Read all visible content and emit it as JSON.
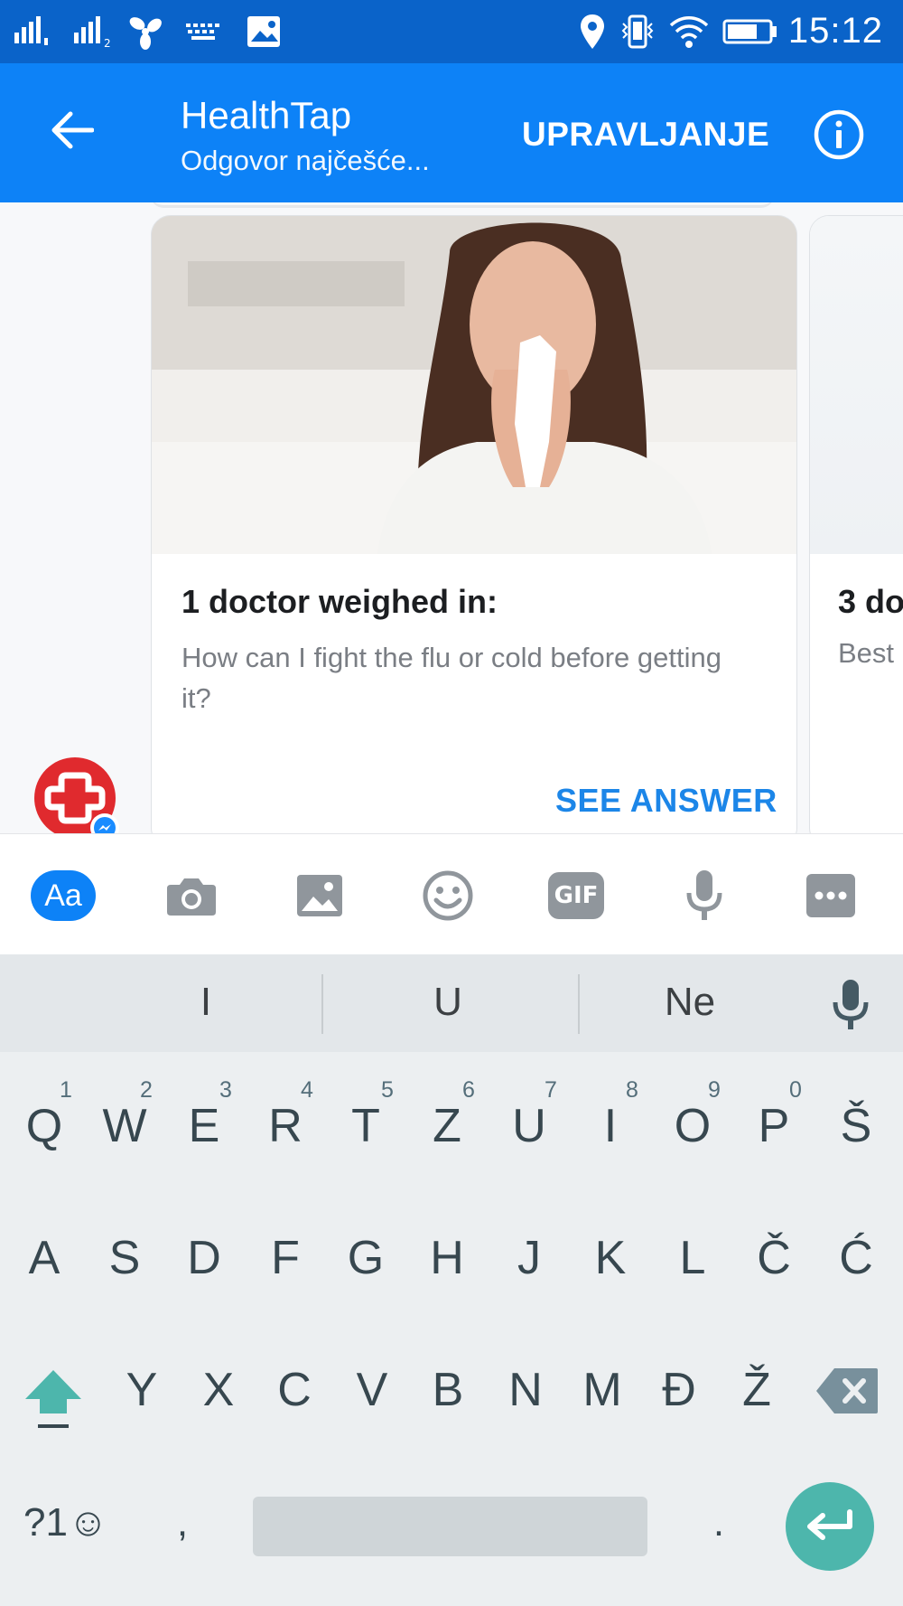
{
  "status_bar": {
    "time": "15:12",
    "icons": [
      "signal-1-icon",
      "signal-2-icon",
      "fan-icon",
      "keyboard-icon",
      "image-icon",
      "location-icon",
      "vibrate-icon",
      "wifi-icon",
      "battery-icon"
    ]
  },
  "header": {
    "title": "HealthTap",
    "subtitle": "Odgovor najčešće...",
    "manage_label": "UPRAVLJANJE"
  },
  "cards": [
    {
      "heading": "1 doctor weighed in:",
      "text": "How can I fight the flu or cold before getting it?",
      "action": "SEE ANSWER"
    },
    {
      "heading": "3 do",
      "text": "Best"
    }
  ],
  "composer": {
    "text_button": "Aa",
    "gif_label": "GIF",
    "tools": [
      "text-icon",
      "camera-icon",
      "gallery-icon",
      "emoji-icon",
      "gif-icon",
      "microphone-icon",
      "more-icon"
    ]
  },
  "keyboard": {
    "suggestions": [
      "I",
      "U",
      "Ne"
    ],
    "row1": [
      "Q",
      "W",
      "E",
      "R",
      "T",
      "Z",
      "U",
      "I",
      "O",
      "P",
      "Š"
    ],
    "row1_hints": [
      "1",
      "2",
      "3",
      "4",
      "5",
      "6",
      "7",
      "8",
      "9",
      "0"
    ],
    "row2": [
      "A",
      "S",
      "D",
      "F",
      "G",
      "H",
      "J",
      "K",
      "L",
      "Č",
      "Ć"
    ],
    "row3": [
      "Y",
      "X",
      "C",
      "V",
      "B",
      "N",
      "M",
      "Đ",
      "Ž"
    ],
    "symbols_label": "?1☺",
    "comma": ",",
    "period": "."
  },
  "colors": {
    "status_bar": "#0a63c9",
    "header": "#0d82f7",
    "link_blue": "#1c86e8",
    "enter_key": "#4db6ac",
    "shift_key": "#4db6ac"
  }
}
